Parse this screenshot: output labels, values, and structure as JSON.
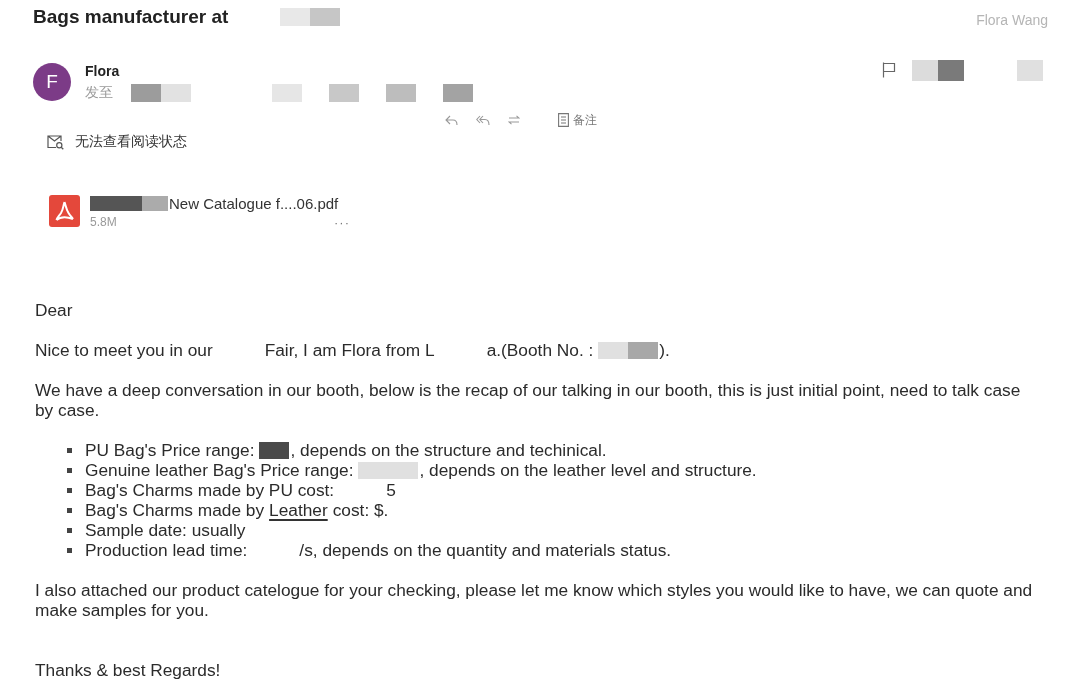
{
  "header": {
    "subject": [
      {
        "kind": "text",
        "text": "Bags manufacturer at"
      },
      {
        "kind": "gap"
      },
      {
        "kind": "redaction",
        "color": "#e8e8e8"
      },
      {
        "kind": "redaction",
        "color": "#c6c6c6"
      }
    ],
    "account": "Flora Wang"
  },
  "sender": {
    "initial": "F",
    "name": "Flora",
    "to_label": "发至",
    "recipients": [
      {
        "kind": "redaction",
        "color": "#9c9c9c"
      },
      {
        "kind": "redaction",
        "color": "#e2e2e2"
      },
      {
        "kind": "gap"
      },
      {
        "kind": "gap"
      },
      {
        "kind": "gap"
      },
      {
        "kind": "redaction",
        "color": "#e6e6e6"
      },
      {
        "kind": "gap"
      },
      {
        "kind": "redaction",
        "color": "#c8c8c8"
      },
      {
        "kind": "gap"
      },
      {
        "kind": "redaction",
        "color": "#bdbdbd"
      },
      {
        "kind": "gap"
      },
      {
        "kind": "redaction",
        "color": "#a3a3a3"
      }
    ],
    "flag_area": [
      {
        "kind": "redaction",
        "color": "#dcdcdc"
      },
      {
        "kind": "redaction",
        "color": "#7a7a7a"
      },
      {
        "kind": "gap"
      },
      {
        "kind": "redaction",
        "color": "#e0e0e0"
      }
    ]
  },
  "actions": {
    "note": "备注"
  },
  "read_status": "无法查看阅读状态",
  "attachment": {
    "name": [
      {
        "kind": "redaction",
        "color": "#555555"
      },
      {
        "kind": "redaction",
        "color": "#555555"
      },
      {
        "kind": "redaction",
        "color": "#ababab"
      },
      {
        "kind": "text",
        "text": "New Catalogue f....06.pdf"
      }
    ],
    "size": "5.8M",
    "more": "···"
  },
  "body": [
    {
      "kind": "paragraph",
      "segments": [
        {
          "kind": "text",
          "text": "Dear"
        }
      ]
    },
    {
      "kind": "paragraph",
      "segments": [
        {
          "kind": "text",
          "text": "Nice to meet you in our"
        },
        {
          "kind": "gap"
        },
        {
          "kind": "text",
          "text": "Fair, I am Flora from L"
        },
        {
          "kind": "gap"
        },
        {
          "kind": "text",
          "text": "a.(Booth No. :"
        },
        {
          "kind": "redaction",
          "color": "#e0e0e0"
        },
        {
          "kind": "redaction",
          "color": "#a8a8a8"
        },
        {
          "kind": "text",
          "text": ")."
        }
      ]
    },
    {
      "kind": "paragraph",
      "segments": [
        {
          "kind": "text",
          "text": "We have a deep conversation in our booth, below is the recap of our talking in our booth, this is just initial point, need to talk case by case."
        }
      ]
    },
    {
      "kind": "list",
      "items": [
        {
          "segments": [
            {
              "kind": "text",
              "text": "PU Bag's Price range:"
            },
            {
              "kind": "redaction",
              "color": "#4a4a4a"
            },
            {
              "kind": "text",
              "text": ", depends on the structure and techinical."
            }
          ]
        },
        {
          "segments": [
            {
              "kind": "text",
              "text": "Genuine leather Bag's Price range:"
            },
            {
              "kind": "redaction",
              "color": "#e0e0e0"
            },
            {
              "kind": "redaction",
              "color": "#e0e0e0"
            },
            {
              "kind": "text",
              "text": ",  depends on the leather level and structure."
            }
          ]
        },
        {
          "segments": [
            {
              "kind": "text",
              "text": "Bag's Charms made by PU cost:"
            },
            {
              "kind": "gap"
            },
            {
              "kind": "text",
              "text": "5"
            }
          ]
        },
        {
          "segments": [
            {
              "kind": "text",
              "text": "Bag's Charms made by"
            },
            {
              "kind": "underlined",
              "text": "Leather"
            },
            {
              "kind": "text",
              "text": "cost: $."
            }
          ]
        },
        {
          "segments": [
            {
              "kind": "text",
              "text": "Sample date: usually"
            }
          ]
        },
        {
          "segments": [
            {
              "kind": "text",
              "text": "Production lead time:"
            },
            {
              "kind": "gap"
            },
            {
              "kind": "text",
              "text": "/s, depends on the quantity and materials status."
            }
          ]
        }
      ]
    },
    {
      "kind": "paragraph",
      "segments": [
        {
          "kind": "text",
          "text": "I also attached our product catelogue for your checking, please let me know which styles you would like to have, we can quote and make samples for you."
        }
      ]
    },
    {
      "kind": "closing",
      "segments": [
        {
          "kind": "text",
          "text": "Thanks & best Regards!"
        }
      ]
    }
  ]
}
